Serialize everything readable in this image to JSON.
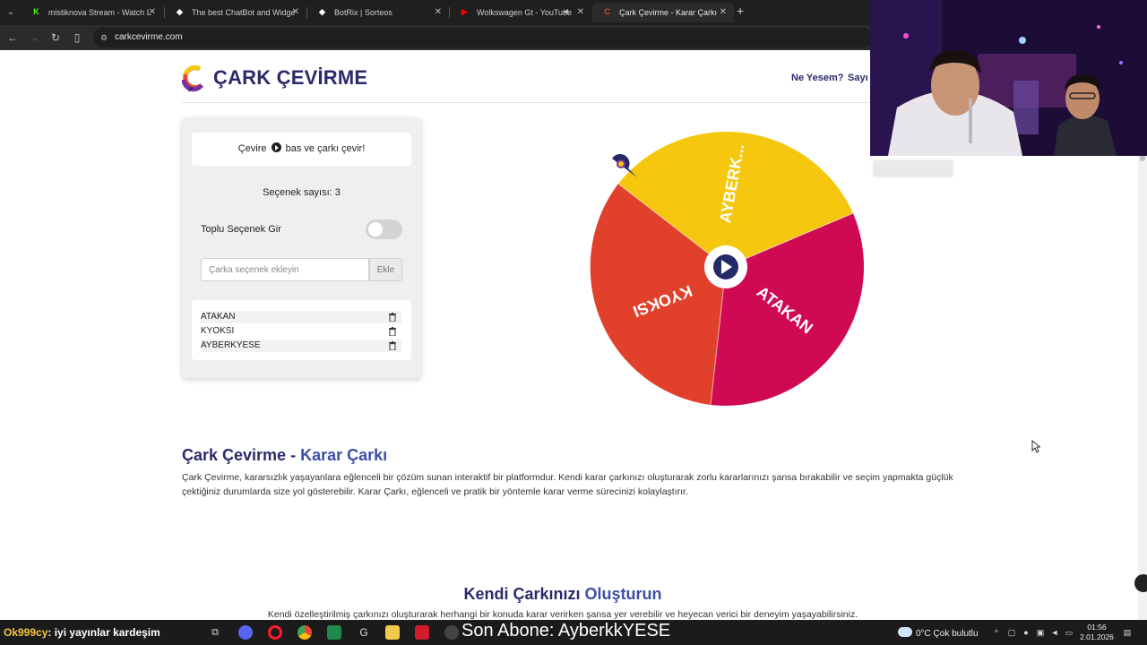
{
  "browser": {
    "tabs": [
      {
        "title": "mistiknova Stream - Watch Live",
        "favicon": "K",
        "favicon_color": "#53fc18",
        "active": false
      },
      {
        "title": "The best ChatBot and Widgets",
        "favicon": "◆",
        "favicon_color": "#ffffff",
        "active": false
      },
      {
        "title": "BotRix | Sorteos",
        "favicon": "◆",
        "favicon_color": "#ffffff",
        "active": false
      },
      {
        "title": "Wolkswagen Gt - YouTube",
        "favicon": "▶",
        "favicon_color": "#ff0000",
        "active": false
      },
      {
        "title": "Çark Çevirme - Karar Çarkı",
        "favicon": "C",
        "favicon_color": "#e4452f",
        "active": true
      }
    ],
    "url": "carkcevirme.com"
  },
  "site": {
    "logo_text": "ÇARK ÇEVİRME",
    "nav": [
      "Ne Yesem?",
      "Sayı Ç"
    ]
  },
  "panel": {
    "hint_before": "Çevire",
    "hint_after": "bas ve çarkı çevir!",
    "count_label": "Seçenek sayısı: 3",
    "bulk_label": "Toplu Seçenek Gir",
    "bulk_enabled": false,
    "input_placeholder": "Çarka seçenek ekleyin",
    "add_label": "Ekle",
    "options": [
      "ATAKAN",
      "KYOKSI",
      "AYBERKYESE"
    ]
  },
  "wheel": {
    "segments": [
      {
        "label": "AYBERK...",
        "color": "#f5c80f"
      },
      {
        "label": "ATAKAN",
        "color": "#cf0a52"
      },
      {
        "label": "KYOKSI",
        "color": "#e1412a"
      }
    ]
  },
  "content": {
    "title_main": "Çark Çevirme - ",
    "title_accent": "Karar Çarkı",
    "paragraph": "Çark Çevirme, kararsızlık yaşayanlara eğlenceli bir çözüm sunan interaktif bir platformdur. Kendi karar çarkınızı oluşturarak zorlu kararlarınızı şansa bırakabilir ve seçim yapmakta güçlük çektiğiniz durumlarda size yol gösterebilir. Karar Çarkı, eğlenceli ve pratik bir yöntemle karar verme sürecinizi kolaylaştırır.",
    "title2_main": "Kendi Çarkınızı ",
    "title2_accent": "Oluşturun",
    "paragraph2": "Kendi özelleştirilmiş çarkınızı oluşturarak herhangi bir konuda karar verirken şansa yer verebilir ve heyecan verici bir deneyim yaşayabilirsiniz."
  },
  "overlay": {
    "ticker_user": "Ok999cy",
    "ticker_message": ": iyi yayınlar kardeşim",
    "sub_banner": "Son Abone: AyberkkYESE"
  },
  "taskbar": {
    "weather": "0°C  Çok bulutlu",
    "time": "01:56",
    "date": "2.01.2026"
  }
}
